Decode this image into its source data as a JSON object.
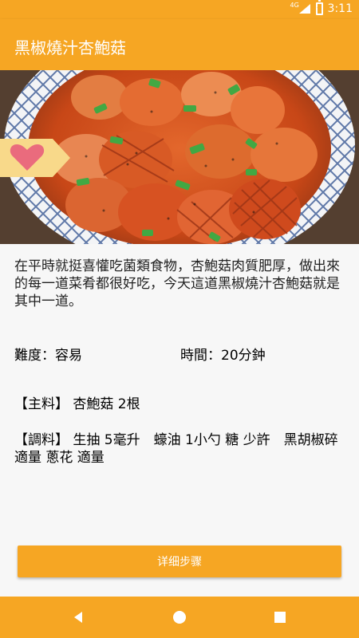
{
  "status_bar": {
    "network": "4G",
    "time": "3:11",
    "icons": [
      "signal-icon",
      "battery-charging-icon"
    ]
  },
  "app_bar": {
    "title": "黑椒燒汁杏鮑菇"
  },
  "hero": {
    "image_subject": "dish-photo",
    "favorite_icon": "heart-icon"
  },
  "recipe": {
    "description": "在平時就挺喜懽吃菌類食物，杏鮑菇肉質肥厚，做出來的每一道菜肴都很好吃，今天這道黑椒燒汁杏鮑菇就是其中一道。",
    "difficulty": "難度：容易",
    "time": "時間：20分鈡",
    "main_ingredients": "【主料】 杏鮑菇 2根",
    "seasonings": "【調料】 生抽 5毫升　蠔油 1小勺 糖 少許　黑胡椒碎 適量 蔥花 適量"
  },
  "actions": {
    "detail_steps": "详细步骤"
  },
  "nav": {
    "icons": [
      "back-icon",
      "home-icon",
      "recent-apps-icon"
    ]
  },
  "colors": {
    "primary": "#f6a623",
    "ribbon": "#f8d98a",
    "heart": "#ea6b7d"
  }
}
